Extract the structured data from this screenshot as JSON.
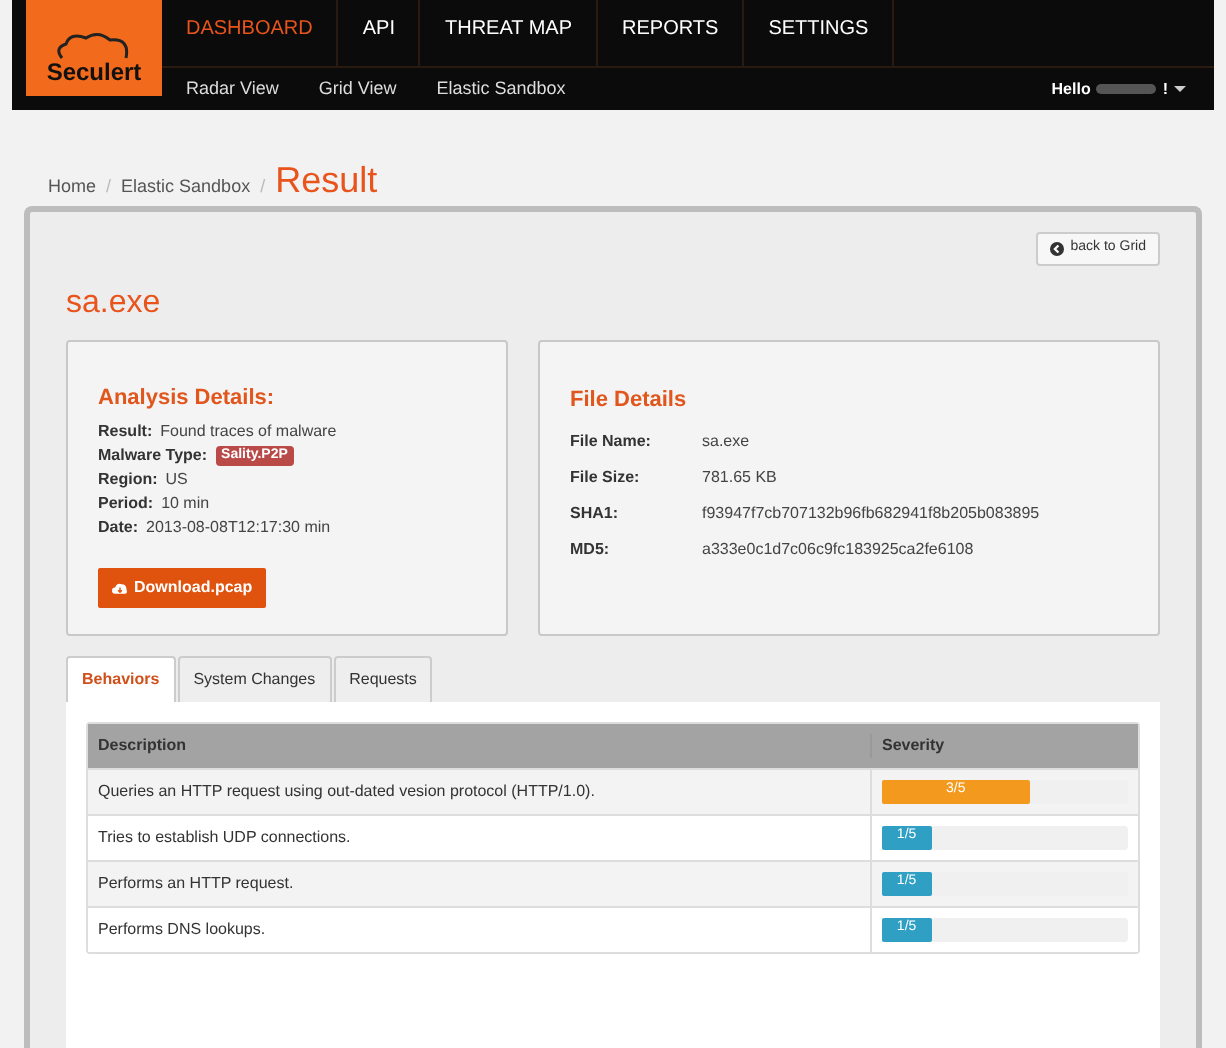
{
  "logo": {
    "text": "Seculert"
  },
  "main_nav": [
    {
      "label": "DASHBOARD",
      "selected": true
    },
    {
      "label": "API",
      "selected": false
    },
    {
      "label": "THREAT MAP",
      "selected": false
    },
    {
      "label": "REPORTS",
      "selected": false
    },
    {
      "label": "SETTINGS",
      "selected": false
    }
  ],
  "sub_nav": [
    "Radar View",
    "Grid View",
    "Elastic Sandbox"
  ],
  "user_menu": {
    "greeting": "Hello",
    "suffix": "!"
  },
  "breadcrumb": {
    "items": [
      {
        "label": "Home",
        "separator": "/"
      },
      {
        "label": "Elastic Sandbox",
        "separator": "/"
      }
    ],
    "current": "Result"
  },
  "back_button": "back to Grid",
  "file_title": "sa.exe",
  "analysis": {
    "title": "Analysis Details:",
    "fields": [
      {
        "label": "Result:",
        "value": "Found traces of malware",
        "kind": "text"
      },
      {
        "label": "Malware Type:",
        "value": "Sality.P2P",
        "kind": "badge"
      },
      {
        "label": "Region:",
        "value": "US",
        "kind": "text"
      },
      {
        "label": "Period:",
        "value": "10 min",
        "kind": "text"
      },
      {
        "label": "Date:",
        "value": "2013-08-08T12:17:30 min",
        "kind": "text"
      }
    ],
    "download_button": "Download.pcap"
  },
  "file_details": {
    "title": "File Details",
    "fields": [
      {
        "label": "File Name:",
        "value": "sa.exe"
      },
      {
        "label": "File Size:",
        "value": "781.65 KB"
      },
      {
        "label": "SHA1:",
        "value": "f93947f7cb707132b96fb682941f8b205b083895"
      },
      {
        "label": "MD5:",
        "value": "a333e0c1d7c06c9fc183925ca2fe6108"
      }
    ]
  },
  "tabs": [
    {
      "label": "Behaviors",
      "selected": true
    },
    {
      "label": "System Changes",
      "selected": false
    },
    {
      "label": "Requests",
      "selected": false
    }
  ],
  "table": {
    "columns": [
      "Description",
      "Severity"
    ],
    "rows": [
      {
        "description": "Queries an HTTP request using out-dated vesion protocol (HTTP/1.0).",
        "severity": "3/5",
        "level": 0.6,
        "color": "#f39a1e"
      },
      {
        "description": "Tries to establish UDP connections.",
        "severity": "1/5",
        "level": 0.2,
        "color": "#2f9fc4"
      },
      {
        "description": "Performs an HTTP request.",
        "severity": "1/5",
        "level": 0.2,
        "color": "#2f9fc4"
      },
      {
        "description": "Performs DNS lookups.",
        "severity": "1/5",
        "level": 0.2,
        "color": "#2f9fc4"
      }
    ]
  }
}
